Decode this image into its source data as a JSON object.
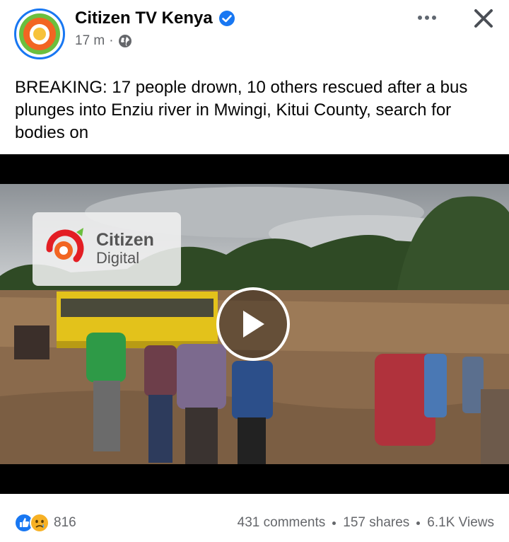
{
  "post": {
    "page_name": "Citizen TV Kenya",
    "timestamp": "17 m",
    "separator": "·",
    "audience_icon": "globe-icon",
    "text": "BREAKING: 17 people drown, 10 others rescued after a bus plunges into Enziu river in Mwingi, Kitui County, search for bodies on"
  },
  "video": {
    "brand_line1": "Citizen",
    "brand_line2": "Digital"
  },
  "footer": {
    "reaction_icons": [
      "like-icon",
      "sad-icon"
    ],
    "reaction_count": "816",
    "comments": "431 comments",
    "shares": "157 shares",
    "views": "6.1K Views"
  },
  "colors": {
    "accent": "#1877f2",
    "brand_orange": "#f26522",
    "brand_red": "#e31e24",
    "brand_green": "#6bbf3e"
  }
}
